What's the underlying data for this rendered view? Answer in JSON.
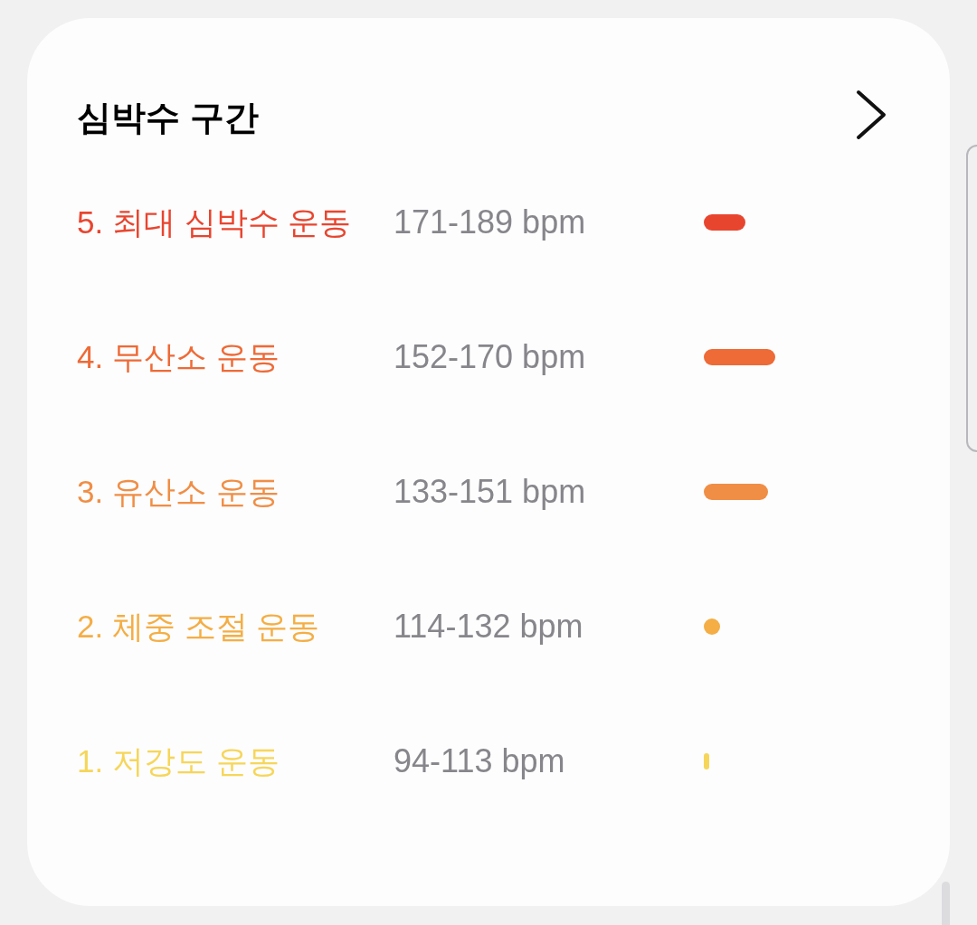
{
  "card": {
    "title": "심박수 구간",
    "zones": [
      {
        "label": "5. 최대 심박수 운동",
        "range": "171-189 bpm",
        "color": "#e8452f"
      },
      {
        "label": "4. 무산소 운동",
        "range": "152-170 bpm",
        "color": "#ee6a36"
      },
      {
        "label": "3. 유산소 운동",
        "range": "133-151 bpm",
        "color": "#f08e45"
      },
      {
        "label": "2. 체중 조절 운동",
        "range": "114-132 bpm",
        "color": "#f4ae45"
      },
      {
        "label": "1. 저강도 운동",
        "range": "94-113 bpm",
        "color": "#f6d65a"
      }
    ]
  }
}
